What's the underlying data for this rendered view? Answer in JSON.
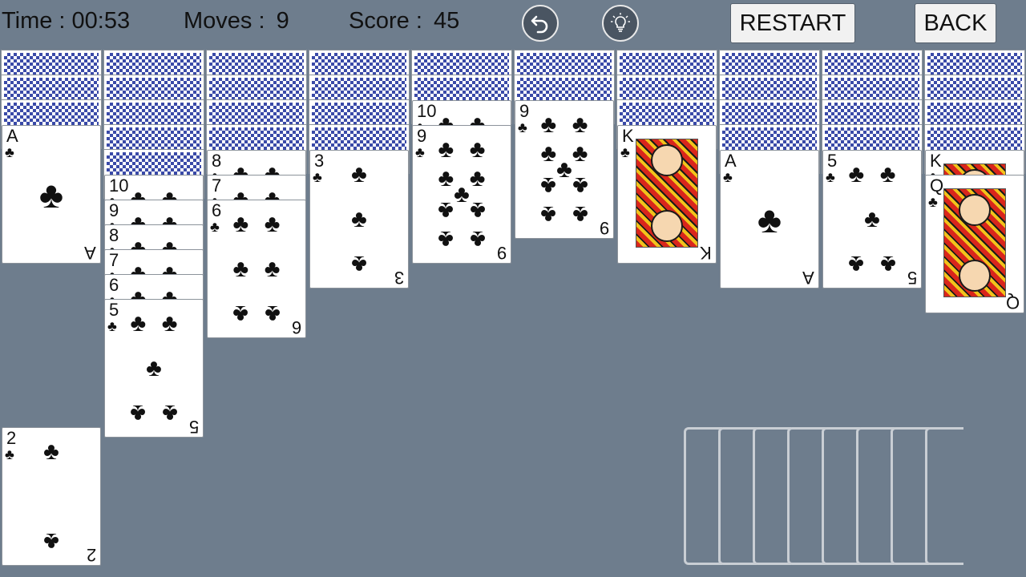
{
  "hud": {
    "time_label": "Time :",
    "time_value": "00:53",
    "moves_label": "Moves :",
    "moves_value": "9",
    "score_label": "Score :",
    "score_value": "45"
  },
  "toolbar": {
    "undo_icon": "undo-icon",
    "hint_icon": "lightbulb-icon",
    "restart_label": "RESTART",
    "back_label": "BACK"
  },
  "suit": "♣",
  "colors": {
    "table": "#6e7d8d",
    "card_back_pattern": "#3a4aa8"
  },
  "columns": [
    {
      "face_down": 3,
      "face_up": [
        "A"
      ]
    },
    {
      "face_down": 5,
      "face_up": [
        "10",
        "9",
        "8",
        "7",
        "6",
        "5"
      ]
    },
    {
      "face_down": 4,
      "face_up": [
        "8",
        "7",
        "6"
      ]
    },
    {
      "face_down": 4,
      "face_up": [
        "3"
      ]
    },
    {
      "face_down": 2,
      "face_up": [
        "10",
        "9"
      ]
    },
    {
      "face_down": 2,
      "face_up": [
        "9"
      ]
    },
    {
      "face_down": 3,
      "face_up": [
        "K"
      ]
    },
    {
      "face_down": 4,
      "face_up": [
        "A"
      ]
    },
    {
      "face_down": 4,
      "face_up": [
        "5"
      ]
    },
    {
      "face_down": 4,
      "face_up": [
        "K",
        "Q"
      ]
    }
  ],
  "completed_card": "2",
  "stock_deals_remaining": 8
}
